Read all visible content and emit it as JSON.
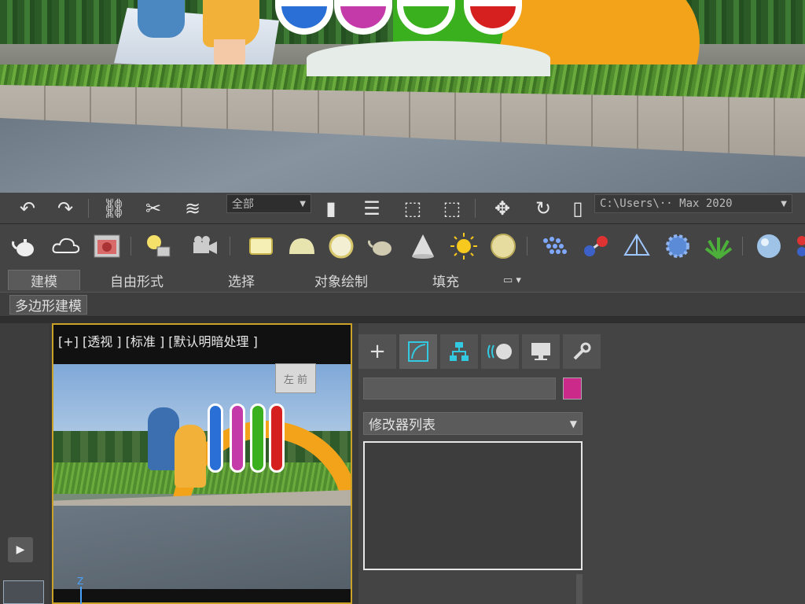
{
  "toolbar1": {
    "icons": [
      "undo-icon",
      "redo-icon",
      "link-icon",
      "unlink-icon",
      "bind-spacewarp-icon"
    ],
    "selection_filter": "全部",
    "project_path": "C:\\Users\\·· Max 2020"
  },
  "toolbar2": {
    "icons": [
      "teapot-icon",
      "cloud-icon",
      "render-frame-icon",
      "light-icon",
      "camera-icon",
      "plane-icon",
      "sphere-icon",
      "light-bulb-icon",
      "teapot-icon",
      "cone-icon",
      "sun-icon",
      "disc-icon",
      "particles-icon",
      "molecule-icon",
      "pyramid-icon",
      "flower-icon",
      "grass-icon",
      "sphere-icon",
      "pipe-icon"
    ]
  },
  "ribbon": {
    "tabs": [
      "建模",
      "自由形式",
      "选择",
      "对象绘制",
      "填充"
    ],
    "active_tab": "建模",
    "subtab": "多边形建模"
  },
  "viewport": {
    "label": "[+] [透视 ] [标准 ] [默认明暗处理 ]",
    "viewcube_label": "左 前",
    "axis_label": "Z"
  },
  "command_panel": {
    "tabs": [
      "create",
      "modify",
      "hierarchy",
      "motion",
      "display",
      "utilities"
    ],
    "modifier_list": "修改器列表",
    "object_color": "#cc2a8a"
  },
  "colors": {
    "viewport_border": "#c9a227",
    "panel_bg": "#444444"
  }
}
